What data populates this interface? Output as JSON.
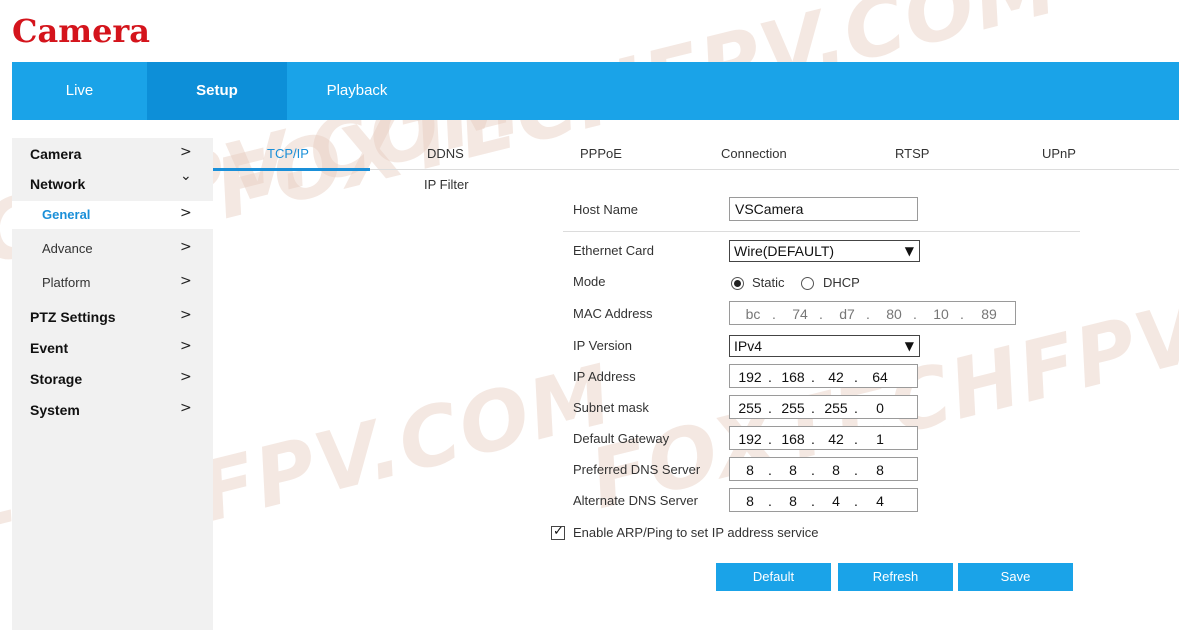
{
  "logo": {
    "text": "Camera",
    "color": "#d4141c"
  },
  "topnav": {
    "tabs": [
      {
        "label": "Live",
        "active": false
      },
      {
        "label": "Setup",
        "active": true
      },
      {
        "label": "Playback",
        "active": false
      }
    ],
    "color": "#1aa3e8"
  },
  "sidebar": {
    "items": [
      {
        "label": "Camera",
        "level": "top",
        "chevron": ">"
      },
      {
        "label": "Network",
        "level": "top",
        "chevron": "⌄"
      },
      {
        "label": "General",
        "level": "sub",
        "chevron": ">",
        "selected": true
      },
      {
        "label": "Advance",
        "level": "sub",
        "chevron": ">"
      },
      {
        "label": "Platform",
        "level": "sub",
        "chevron": ">"
      },
      {
        "label": "PTZ Settings",
        "level": "top",
        "chevron": ">"
      },
      {
        "label": "Event",
        "level": "top",
        "chevron": ">"
      },
      {
        "label": "Storage",
        "level": "top",
        "chevron": ">"
      },
      {
        "label": "System",
        "level": "top",
        "chevron": ">"
      }
    ]
  },
  "subtabs": {
    "tabs": [
      "TCP/IP",
      "DDNS",
      "PPPoE",
      "Connection",
      "RTSP",
      "UPnP"
    ],
    "second_row": "IP Filter",
    "active": "TCP/IP"
  },
  "form": {
    "host_name": {
      "label": "Host Name",
      "value": "VSCamera"
    },
    "ethernet_card": {
      "label": "Ethernet Card",
      "value": "Wire(DEFAULT)"
    },
    "mode": {
      "label": "Mode",
      "static_label": "Static",
      "dhcp_label": "DHCP",
      "selected": "Static"
    },
    "mac_address": {
      "label": "MAC Address",
      "octets": [
        "bc",
        "74",
        "d7",
        "80",
        "10",
        "89"
      ]
    },
    "ip_version": {
      "label": "IP Version",
      "value": "IPv4"
    },
    "ip_address": {
      "label": "IP Address",
      "octets": [
        "192",
        "168",
        "42",
        "64"
      ]
    },
    "subnet_mask": {
      "label": "Subnet mask",
      "octets": [
        "255",
        "255",
        "255",
        "0"
      ]
    },
    "default_gateway": {
      "label": "Default Gateway",
      "octets": [
        "192",
        "168",
        "42",
        "1"
      ]
    },
    "preferred_dns": {
      "label": "Preferred DNS Server",
      "octets": [
        "8",
        "8",
        "8",
        "8"
      ]
    },
    "alternate_dns": {
      "label": "Alternate DNS Server",
      "octets": [
        "8",
        "8",
        "4",
        "4"
      ]
    },
    "enable_arp": {
      "label": "Enable ARP/Ping to set IP address service",
      "checked": true
    }
  },
  "buttons": {
    "default": "Default",
    "refresh": "Refresh",
    "save": "Save"
  },
  "watermark": {
    "text": "FOXTECHFPV.COM"
  }
}
